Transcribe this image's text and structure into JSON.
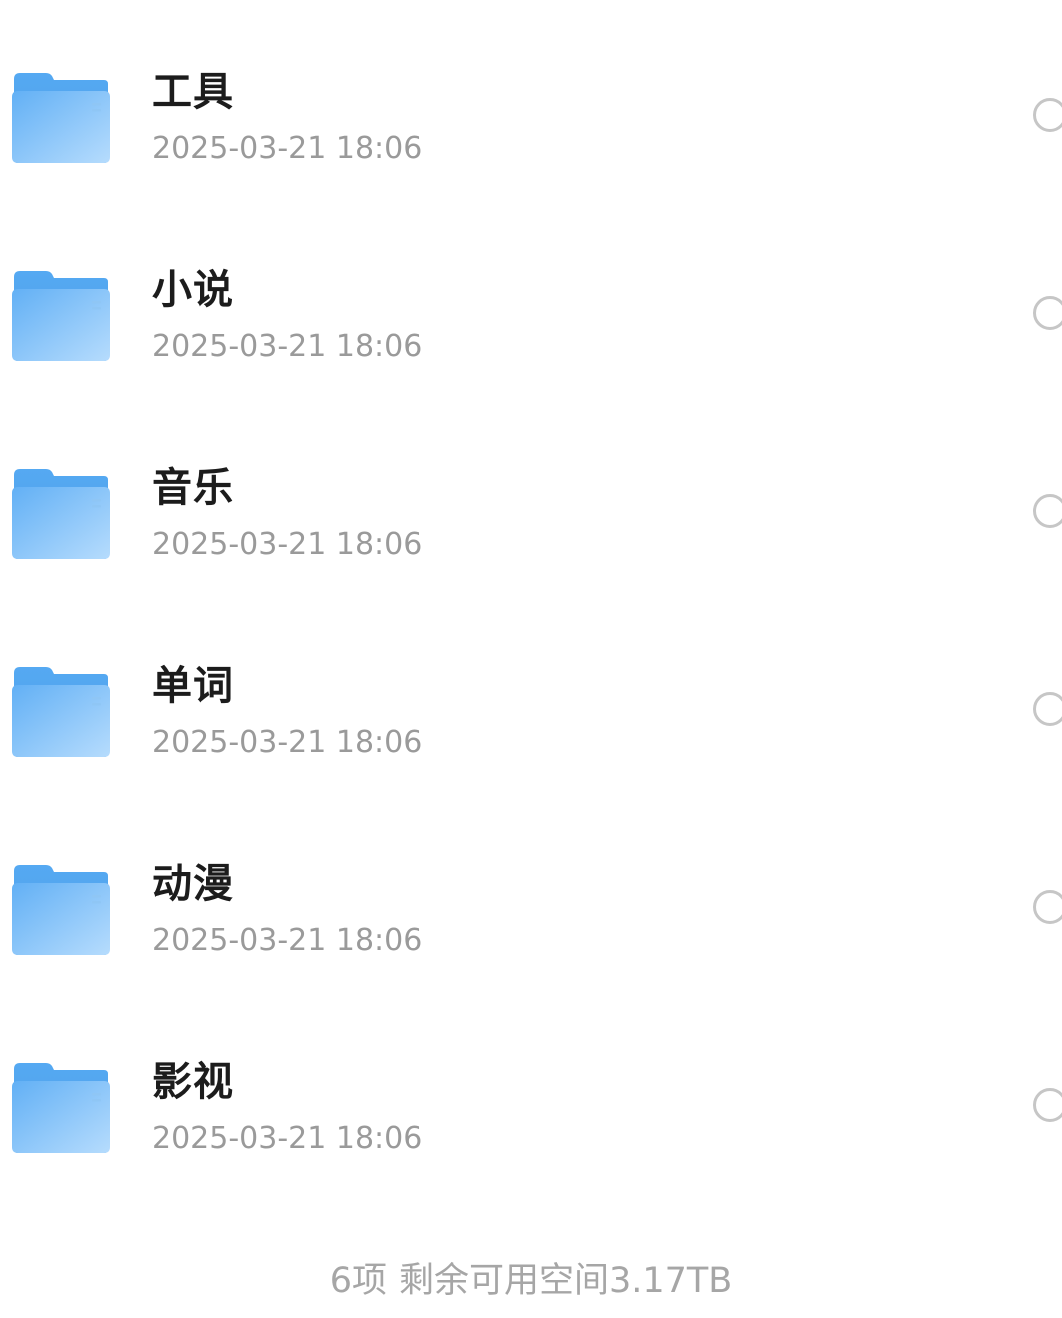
{
  "files": [
    {
      "name": "工具",
      "modified": "2025-03-21 18:06"
    },
    {
      "name": "小说",
      "modified": "2025-03-21 18:06"
    },
    {
      "name": "音乐",
      "modified": "2025-03-21 18:06"
    },
    {
      "name": "单词",
      "modified": "2025-03-21 18:06"
    },
    {
      "name": "动漫",
      "modified": "2025-03-21 18:06"
    },
    {
      "name": "影视",
      "modified": "2025-03-21 18:06"
    }
  ],
  "footer": {
    "count": "6项",
    "free_space": "剩余可用空间3.17TB"
  },
  "colors": {
    "folder_back": "#5aaef5",
    "folder_front_top": "#6cb6f6",
    "folder_front_bottom": "#b4dbfd",
    "title_text": "#1c1c1c",
    "date_text": "#9a9a9a",
    "footer_text": "#a6a6a6",
    "circle_border": "#c6c6c6"
  },
  "icons": {
    "folder": "folder-icon",
    "select": "select-circle-icon"
  }
}
